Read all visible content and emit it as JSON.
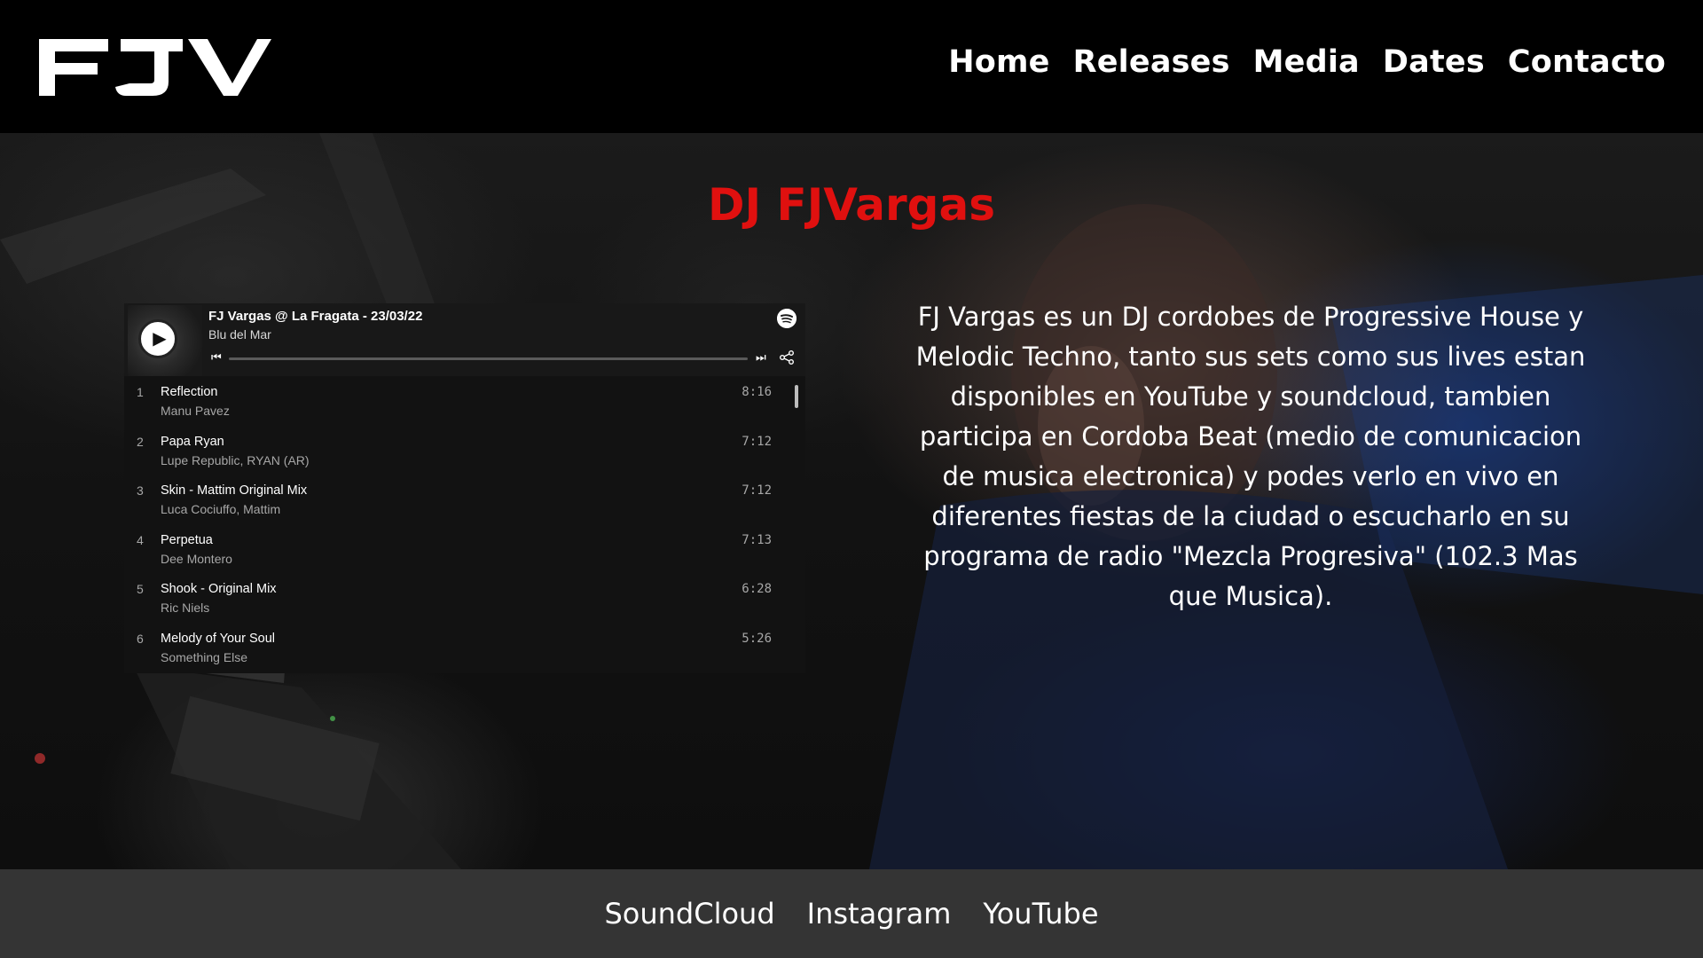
{
  "header": {
    "logo_text": "FJV",
    "nav": [
      "Home",
      "Releases",
      "Media",
      "Dates",
      "Contacto"
    ]
  },
  "hero": {
    "title": "DJ FJVargas",
    "bio": "FJ Vargas es un DJ cordobes de Progressive House y Melodic Techno, tanto sus sets como sus lives estan disponibles en YouTube y soundcloud, tambien participa en Cordoba Beat (medio de comunicacion de musica electronica) y podes verlo en vivo en diferentes fiestas de la ciudad o escucharlo en su programa de radio \"Mezcla Progresiva\" (102.3 Mas que Musica)."
  },
  "player": {
    "episode_title": "FJ Vargas @ La Fragata - 23/03/22",
    "show_name": "Blu del Mar",
    "icons": [
      "play-icon",
      "spotify-icon",
      "previous-icon",
      "next-icon",
      "share-icon"
    ],
    "tracks": [
      {
        "num": "1",
        "title": "Reflection",
        "artist": "Manu Pavez",
        "duration": "8:16"
      },
      {
        "num": "2",
        "title": "Papa Ryan",
        "artist": "Lupe Republic, RYAN (AR)",
        "duration": "7:12"
      },
      {
        "num": "3",
        "title": "Skin - Mattim Original Mix",
        "artist": "Luca Cociuffo, Mattim",
        "duration": "7:12"
      },
      {
        "num": "4",
        "title": "Perpetua",
        "artist": "Dee Montero",
        "duration": "7:13"
      },
      {
        "num": "5",
        "title": "Shook - Original Mix",
        "artist": "Ric Niels",
        "duration": "6:28"
      },
      {
        "num": "6",
        "title": "Melody of Your Soul",
        "artist": "Something Else",
        "duration": "5:26"
      }
    ]
  },
  "footer": {
    "links": [
      "SoundCloud",
      "Instagram",
      "YouTube"
    ]
  },
  "colors": {
    "accent": "#e0100f",
    "header_bg": "#000000",
    "footer_bg": "#343434",
    "player_bg": "#121212"
  }
}
